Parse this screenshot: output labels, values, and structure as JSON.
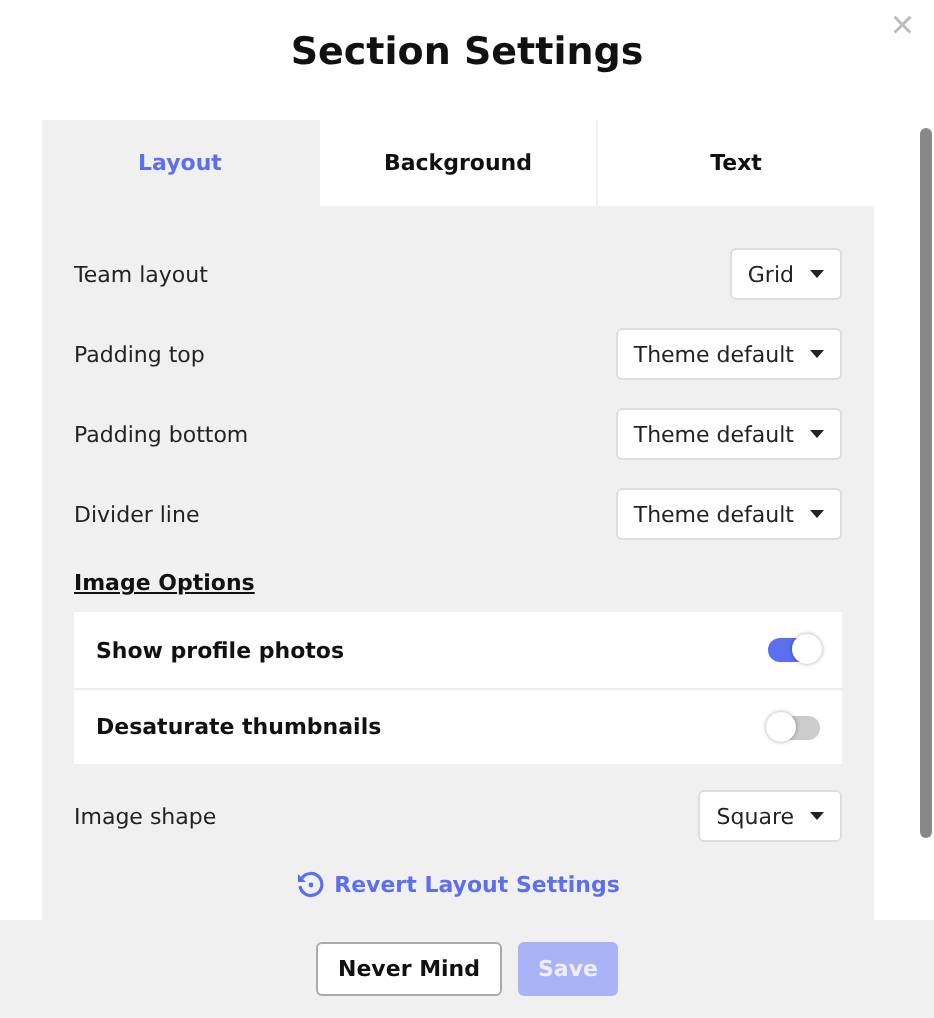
{
  "title": "Section Settings",
  "close": "×",
  "tabs": [
    {
      "label": "Layout",
      "selected": true
    },
    {
      "label": "Background",
      "selected": false
    },
    {
      "label": "Text",
      "selected": false
    }
  ],
  "selects": [
    {
      "label": "Team layout",
      "value": "Grid"
    },
    {
      "label": "Padding top",
      "value": "Theme default"
    },
    {
      "label": "Padding bottom",
      "value": "Theme default"
    },
    {
      "label": "Divider line",
      "value": "Theme default"
    }
  ],
  "image_options": {
    "heading": "Image Options",
    "toggles": [
      {
        "label": "Show profile photos",
        "on": true
      },
      {
        "label": "Desaturate thumbnails",
        "on": false
      }
    ],
    "shape": {
      "label": "Image shape",
      "value": "Square"
    }
  },
  "revert": "Revert Layout Settings",
  "buttons": [
    {
      "label": "Never Mind",
      "disabled": false,
      "kind": "secondary"
    },
    {
      "label": "Save",
      "disabled": true,
      "kind": "primary"
    }
  ]
}
